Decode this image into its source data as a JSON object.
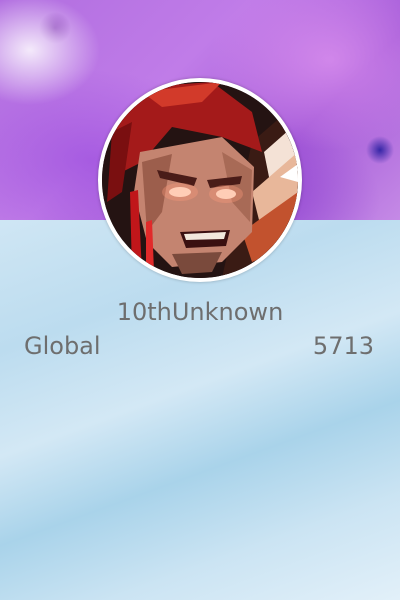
{
  "profile": {
    "username": "10thUnknown",
    "avatar_icon": "character-portrait-icon",
    "stats": [
      {
        "label": "Global",
        "value": "5713"
      }
    ]
  },
  "colors": {
    "banner_purple": "#b16ee0",
    "background_blue": "#bcdcef",
    "text_gray": "#6e6e6e",
    "avatar_border": "#ffffff"
  }
}
